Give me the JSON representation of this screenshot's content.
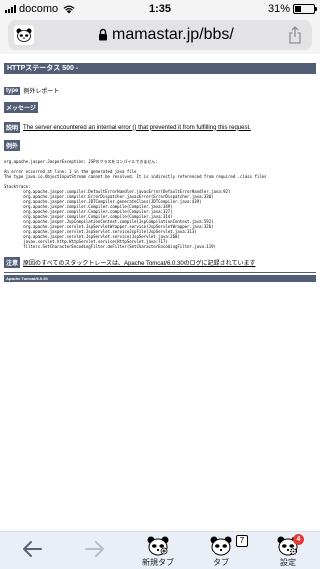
{
  "status_bar": {
    "carrier": "docomo",
    "time": "1:35",
    "battery_percent_text": "31%",
    "battery_level": 0.31
  },
  "address_bar": {
    "url": "mamastar.jp/bbs/"
  },
  "page": {
    "heading": "HTTPステータス 500 -",
    "type_label": "type",
    "type_value": "例外レポート",
    "message_label": "メッセージ",
    "description_label": "説明",
    "description_text": "The server encountered an internal error () that prevented it from fulfilling this request.",
    "exception_label": "例外",
    "exception_text": "org.apache.jasper.JasperException: JSPのクラスをコンパイルできません:\n\nAn error occurred at line: 1 in the generated java file\nThe type java.io.ObjectInputStream cannot be resolved. It is indirectly referenced from required .class files\n\nStacktrace:\n\torg.apache.jasper.compiler.DefaultErrorHandler.javacError(DefaultErrorHandler.java:92)\n\torg.apache.jasper.compiler.ErrorDispatcher.javacError(ErrorDispatcher.java:330)\n\torg.apache.jasper.compiler.JDTCompiler.generateClass(JDTCompiler.java:439)\n\torg.apache.jasper.compiler.Compiler.compile(Compiler.java:349)\n\torg.apache.jasper.compiler.Compiler.compile(Compiler.java:327)\n\torg.apache.jasper.compiler.Compiler.compile(Compiler.java:314)\n\torg.apache.jasper.JspCompilationContext.compile(JspCompilationContext.java:592)\n\torg.apache.jasper.servlet.JspServletWrapper.service(JspServletWrapper.java:326)\n\torg.apache.jasper.servlet.JspServlet.serviceJspFile(JspServlet.java:313)\n\torg.apache.jasper.servlet.JspServlet.service(JspServlet.java:260)\n\tjavax.servlet.http.HttpServlet.service(HttpServlet.java:717)\n\tfilters.SetCharacterEncodingFilter.doFilter(SetCharacterEncodingFilter.java:119)",
    "note_label": "注意",
    "note_text": "原因のすべてのスタックトレースは、Apache Tomcat/6.0.30のログに記録されています",
    "footer": "Apache Tomcat/6.0.30"
  },
  "toolbar": {
    "new_tab_label": "新規タブ",
    "tabs_label": "タブ",
    "tab_count": "7",
    "settings_label": "設定",
    "settings_badge": "4"
  }
}
